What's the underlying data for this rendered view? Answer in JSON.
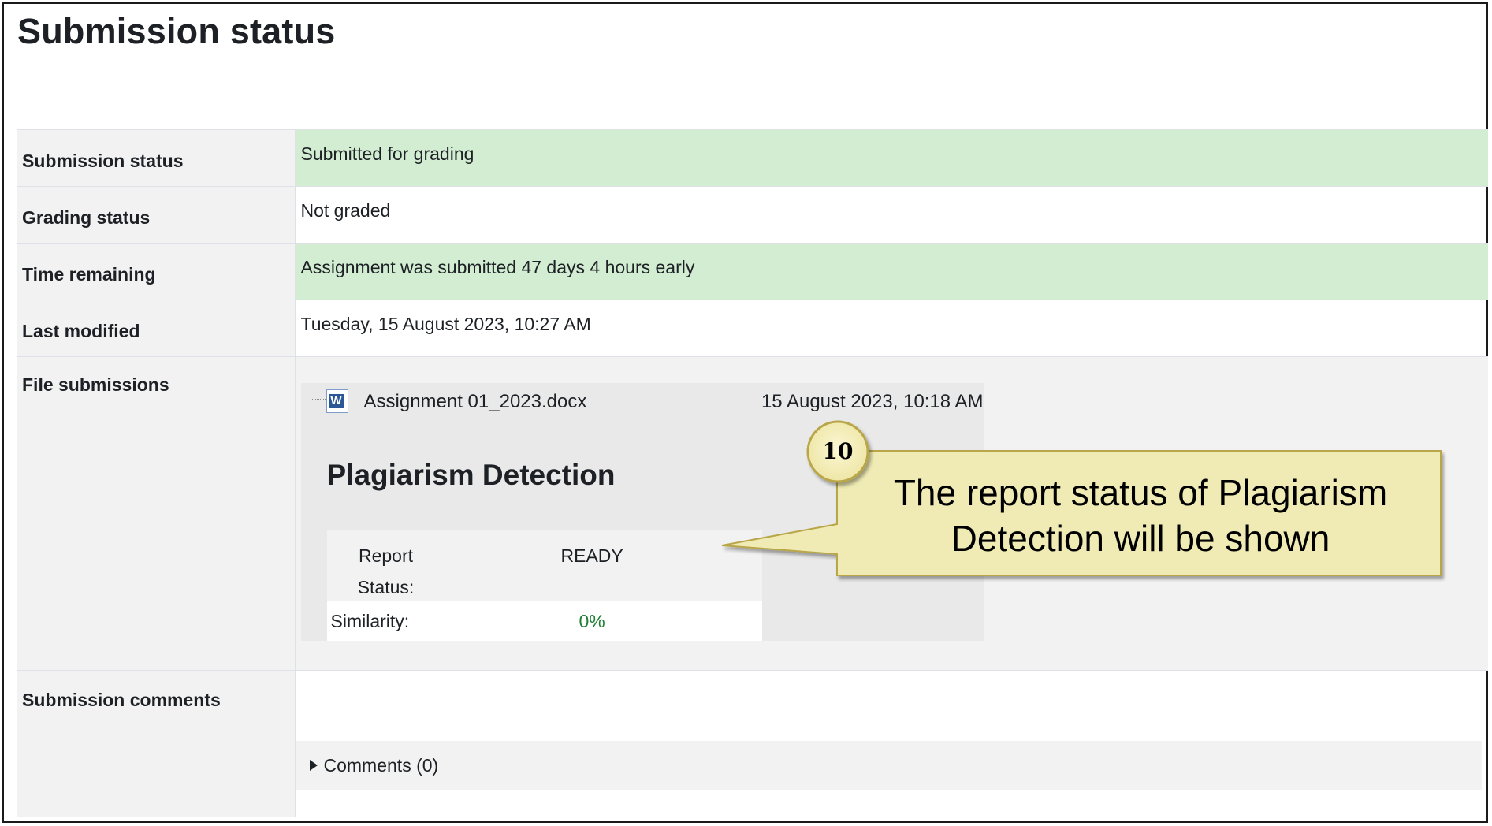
{
  "page": {
    "title": "Submission status"
  },
  "rows": [
    {
      "label": "Submission status",
      "value": "Submitted for grading"
    },
    {
      "label": "Grading status",
      "value": "Not graded"
    },
    {
      "label": "Time remaining",
      "value": "Assignment was submitted 47 days 4 hours early"
    },
    {
      "label": "Last modified",
      "value": "Tuesday, 15 August 2023, 10:27 AM"
    }
  ],
  "files": {
    "label": "File submissions",
    "file_icon": "word-doc-icon",
    "file_icon_letter": "W",
    "file_name": "Assignment 01_2023.docx",
    "file_date": "15 August 2023, 10:18 AM",
    "plagiarism": {
      "title": "Plagiarism Detection",
      "report_status_label": "Report Status:",
      "report_status_value": "READY",
      "similarity_label": "Similarity:",
      "similarity_value": "0%"
    }
  },
  "comments": {
    "label": "Submission comments",
    "toggle": "Comments (0)"
  },
  "callout": {
    "step": "10",
    "text": "The report status of Plagiarism Detection will be shown"
  },
  "colors": {
    "success_bg": "#d2edd2",
    "header_bg": "#f2f2f2",
    "callout_fill": "#f0ebb4",
    "similarity_text": "#1e7e34"
  }
}
